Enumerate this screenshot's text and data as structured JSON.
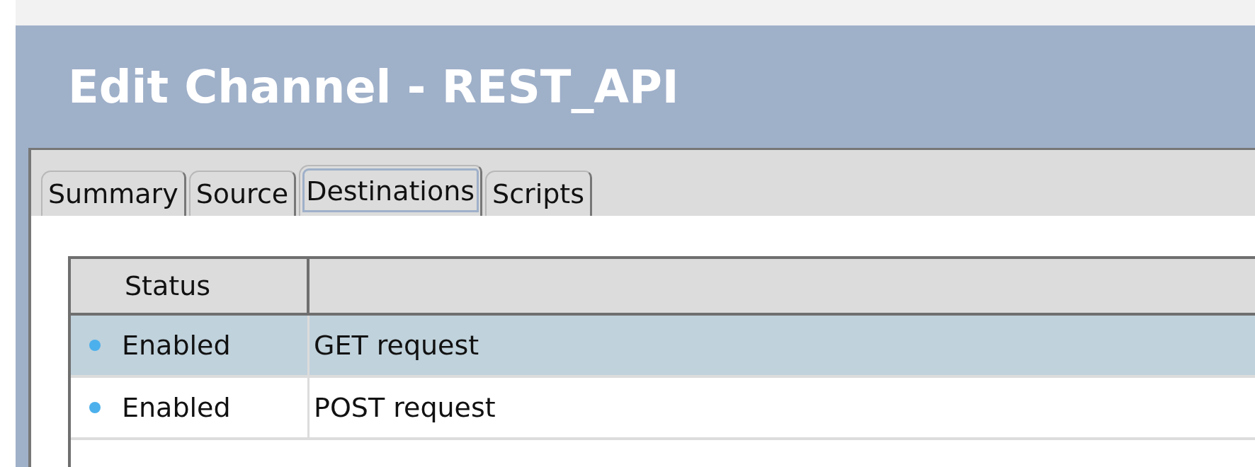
{
  "window": {
    "title": "Edit Channel - REST_API"
  },
  "tabs": [
    {
      "label": "Summary",
      "selected": false
    },
    {
      "label": "Source",
      "selected": false
    },
    {
      "label": "Destinations",
      "selected": true
    },
    {
      "label": "Scripts",
      "selected": false
    }
  ],
  "table": {
    "columns": [
      "Status"
    ],
    "rows": [
      {
        "status": "Enabled",
        "color": "#4cb0ec",
        "name": "GET request",
        "selected": true
      },
      {
        "status": "Enabled",
        "color": "#4cb0ec",
        "name": "POST request",
        "selected": false
      }
    ]
  }
}
